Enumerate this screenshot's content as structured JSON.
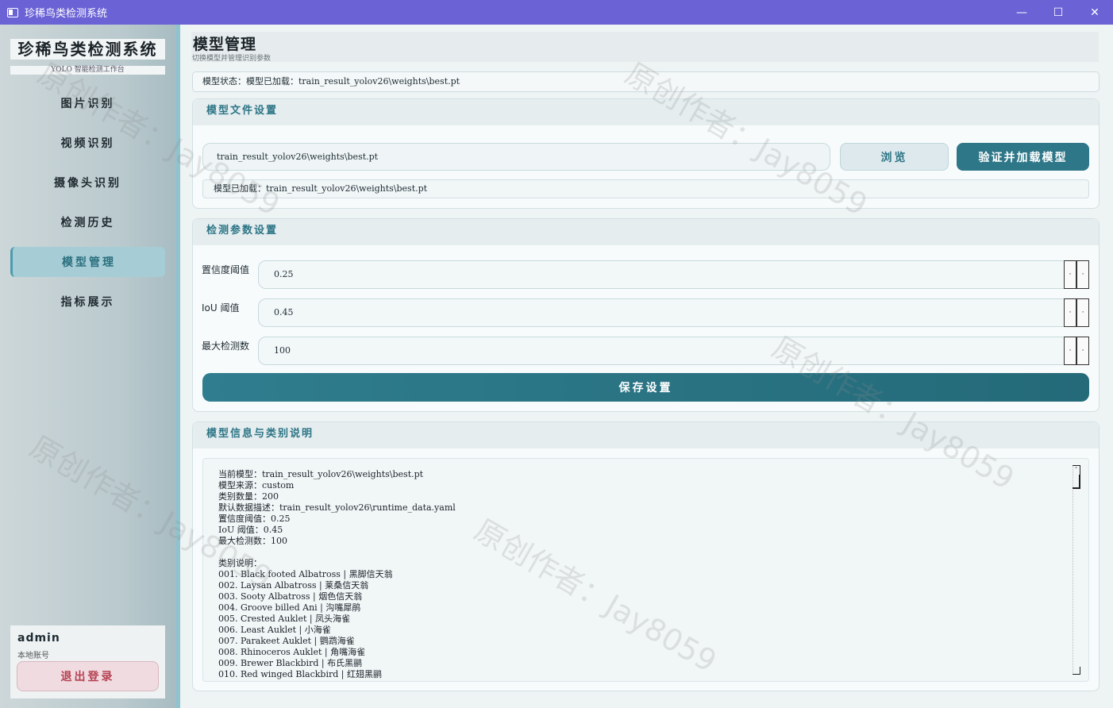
{
  "window": {
    "title": "珍稀鸟类检测系统",
    "minimize": "—",
    "maximize": "☐",
    "close": "✕"
  },
  "sidebar": {
    "brand_title": "珍稀鸟类检测系统",
    "brand_subtitle": "YOLO 智能检测工作台",
    "items": [
      {
        "label": "图片识别",
        "active": false
      },
      {
        "label": "视频识别",
        "active": false
      },
      {
        "label": "摄像头识别",
        "active": false
      },
      {
        "label": "检测历史",
        "active": false
      },
      {
        "label": "模型管理",
        "active": true
      },
      {
        "label": "指标展示",
        "active": false
      }
    ],
    "user": {
      "name": "admin",
      "role": "本地账号",
      "logout_label": "退出登录"
    }
  },
  "main": {
    "title": "模型管理",
    "subtitle": "切换模型并管理识别参数",
    "status": "模型状态：模型已加载：train_result_yolov26\\weights\\best.pt",
    "model_file": {
      "heading": "模型文件设置",
      "path_value": "train_result_yolov26\\weights\\best.pt",
      "browse_label": "浏览",
      "load_label": "验证并加载模型",
      "loaded_text": "模型已加载：train_result_yolov26\\weights\\best.pt"
    },
    "params": {
      "heading": "检测参数设置",
      "confidence_label": "置信度阈值",
      "confidence_value": "0.25",
      "iou_label": "IoU 阈值",
      "iou_value": "0.45",
      "max_label": "最大检测数",
      "max_value": "100",
      "spin_up": "·",
      "spin_down": "·",
      "save_label": "保存设置"
    },
    "info": {
      "heading": "模型信息与类别说明",
      "lines": [
        "当前模型：train_result_yolov26\\weights\\best.pt",
        "模型来源：custom",
        "类别数量：200",
        "默认数据描述：train_result_yolov26\\runtime_data.yaml",
        "置信度阈值：0.25",
        "IoU 阈值：0.45",
        "最大检测数：100",
        "",
        "类别说明：",
        "001. Black footed Albatross | 黑脚信天翁",
        "002. Laysan Albatross | 莱桑信天翁",
        "003. Sooty Albatross | 烟色信天翁",
        "004. Groove billed Ani | 沟嘴犀鹃",
        "005. Crested Auklet | 凤头海雀",
        "006. Least Auklet | 小海雀",
        "007. Parakeet Auklet | 鹦鹉海雀",
        "008. Rhinoceros Auklet | 角嘴海雀",
        "009. Brewer Blackbird | 布氏黑鹂",
        "010. Red winged Blackbird | 红翅黑鹂"
      ]
    }
  },
  "watermark": "原创作者：Jay8059"
}
